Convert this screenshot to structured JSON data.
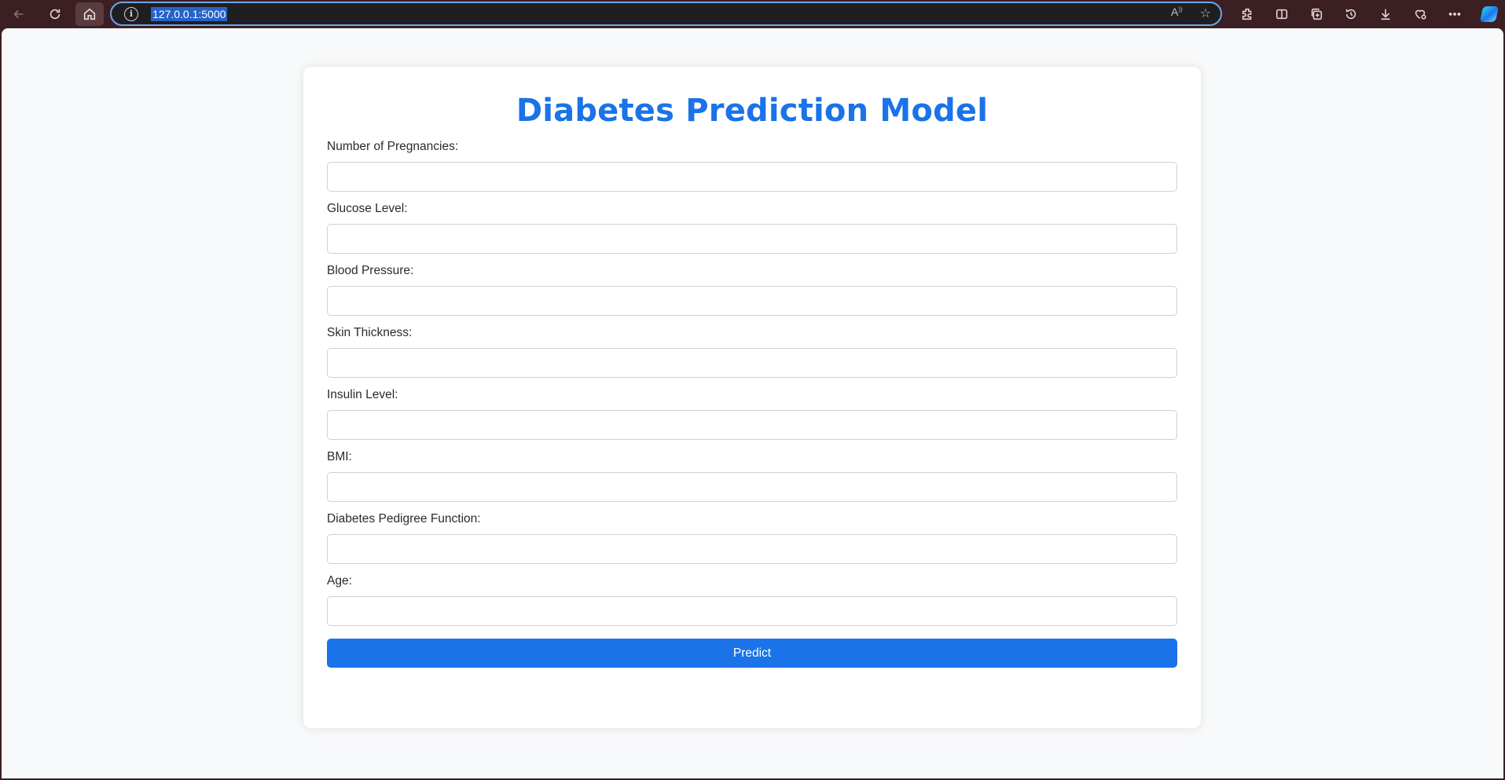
{
  "browser": {
    "url": "127.0.0.1:5000",
    "icons": [
      "back-arrow-icon",
      "refresh-icon",
      "home-icon",
      "site-info-icon",
      "read-aloud-icon",
      "favorite-star-icon",
      "extensions-icon",
      "split-screen-icon",
      "collections-icon",
      "history-icon",
      "downloads-icon",
      "browser-essentials-icon",
      "more-icon",
      "copilot-icon"
    ],
    "accent_color": "#6fa4e8",
    "frame_color": "#3b1f22"
  },
  "form": {
    "title": "Diabetes Prediction Model",
    "title_color": "#1a73e8",
    "fields": [
      {
        "label": "Number of Pregnancies:",
        "value": ""
      },
      {
        "label": "Glucose Level:",
        "value": ""
      },
      {
        "label": "Blood Pressure:",
        "value": ""
      },
      {
        "label": "Skin Thickness:",
        "value": ""
      },
      {
        "label": "Insulin Level:",
        "value": ""
      },
      {
        "label": "BMI:",
        "value": ""
      },
      {
        "label": "Diabetes Pedigree Function:",
        "value": ""
      },
      {
        "label": "Age:",
        "value": ""
      }
    ],
    "submit_label": "Predict",
    "submit_color": "#1a73e8"
  }
}
